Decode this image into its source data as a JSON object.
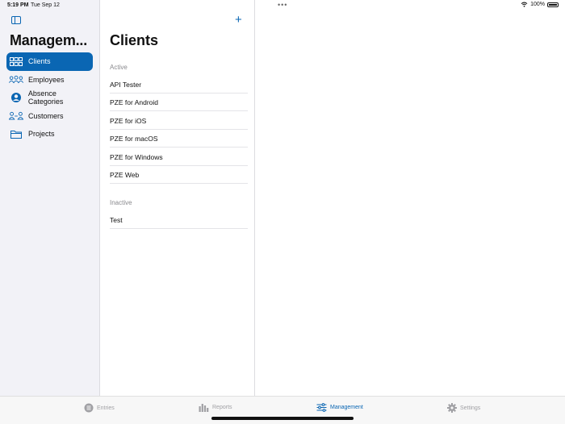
{
  "status": {
    "time": "5:19 PM",
    "date": "Tue Sep 12",
    "battery": "100%"
  },
  "sidebar": {
    "title": "Managem...",
    "items": [
      {
        "label": "Clients",
        "icon": "grid-icon",
        "active": true
      },
      {
        "label": "Employees",
        "icon": "people-icon",
        "active": false
      },
      {
        "label": "Absence Categories",
        "icon": "person-circle-icon",
        "active": false
      },
      {
        "label": "Customers",
        "icon": "customers-icon",
        "active": false
      },
      {
        "label": "Projects",
        "icon": "folder-icon",
        "active": false
      }
    ]
  },
  "list": {
    "add_label": "+",
    "title": "Clients",
    "active_header": "Active",
    "active_items": [
      "API Tester",
      "PZE for Android",
      "PZE for iOS",
      "PZE for macOS",
      "PZE for Windows",
      "PZE Web"
    ],
    "inactive_header": "Inactive",
    "inactive_items": [
      "Test"
    ]
  },
  "tabs": [
    {
      "label": "Entries",
      "icon": "list-circle-icon",
      "active": false
    },
    {
      "label": "Reports",
      "icon": "bar-chart-icon",
      "active": false
    },
    {
      "label": "Management",
      "icon": "sliders-icon",
      "active": true
    },
    {
      "label": "Settings",
      "icon": "gear-icon",
      "active": false
    }
  ],
  "colors": {
    "accent": "#0a66b3",
    "sidebar_bg": "#f2f2f7"
  }
}
